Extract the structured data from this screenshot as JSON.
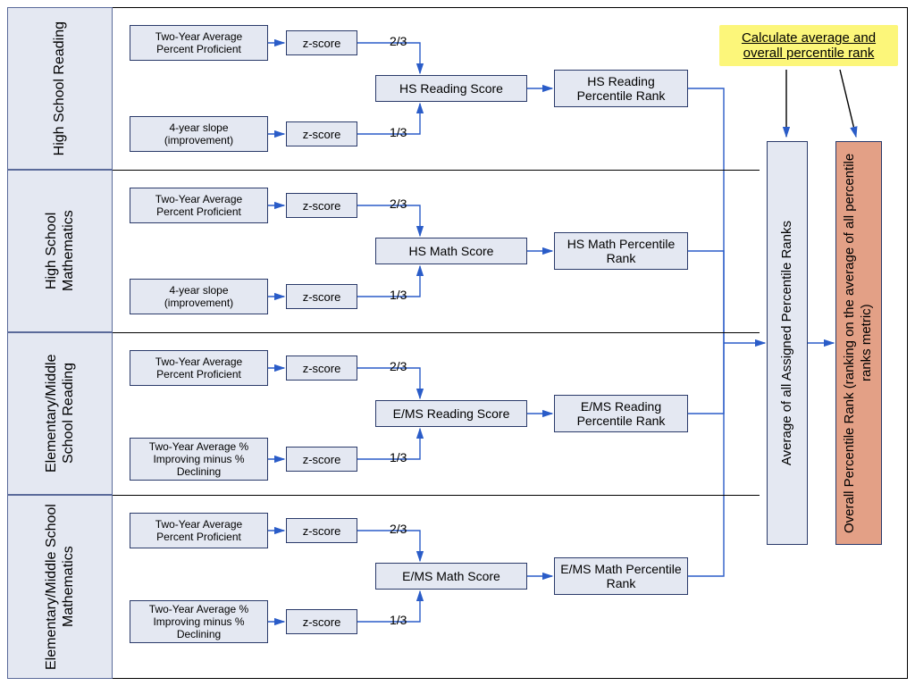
{
  "note": "Calculate average and overall percentile rank",
  "weights": {
    "upper": "2/3",
    "lower": "1/3"
  },
  "zscore": "z-score",
  "rows": [
    {
      "label": "High School Reading",
      "inputA": "Two-Year Average Percent Proficient",
      "inputB": "4-year slope (improvement)",
      "score": "HS Reading Score",
      "rank": "HS Reading Percentile Rank"
    },
    {
      "label": "High School Mathematics",
      "inputA": "Two-Year Average Percent Proficient",
      "inputB": "4-year slope (improvement)",
      "score": "HS Math Score",
      "rank": "HS Math Percentile Rank"
    },
    {
      "label": "Elementary/Middle School Reading",
      "inputA": "Two-Year Average Percent Proficient",
      "inputB": "Two-Year Average % Improving minus % Declining",
      "score": "E/MS Reading Score",
      "rank": "E/MS Reading Percentile Rank"
    },
    {
      "label": "Elementary/Middle School Mathematics",
      "inputA": "Two-Year Average Percent Proficient",
      "inputB": "Two-Year Average % Improving minus % Declining",
      "score": "E/MS Math Score",
      "rank": "E/MS Math Percentile Rank"
    }
  ],
  "avg_box": "Average of all Assigned Percentile Ranks",
  "final_box": "Overall Percentile Rank\n(ranking on the average of all percentile ranks metric)"
}
